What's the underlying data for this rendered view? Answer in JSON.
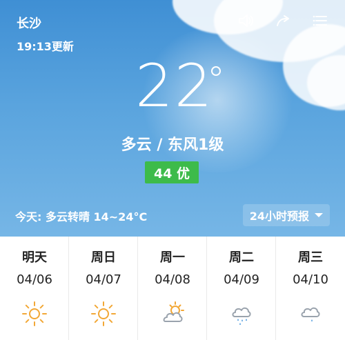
{
  "header": {
    "city": "长沙",
    "updated": "19:13更新",
    "icons": [
      "speaker-icon",
      "share-icon",
      "menu-icon"
    ]
  },
  "current": {
    "temperature": "22",
    "condition": "多云 / 东风1级",
    "aqi": "44 优",
    "today": "今天:  多云转晴   14~24°C"
  },
  "controls": {
    "hourly": "24小时预报"
  },
  "forecast": [
    {
      "day": "明天",
      "date": "04/06",
      "icon": "sunny-icon"
    },
    {
      "day": "周日",
      "date": "04/07",
      "icon": "sunny-icon"
    },
    {
      "day": "周一",
      "date": "04/08",
      "icon": "partly-cloudy-icon"
    },
    {
      "day": "周二",
      "date": "04/09",
      "icon": "cloud-rain-icon"
    },
    {
      "day": "周三",
      "date": "04/10",
      "icon": "cloud-rain-icon"
    }
  ],
  "colors": {
    "aqi_bg": "#3dbb4a",
    "sun_icon": "#f2a735",
    "cloud_icon": "#9aa3ad",
    "rain_icon": "#2b88d8"
  }
}
